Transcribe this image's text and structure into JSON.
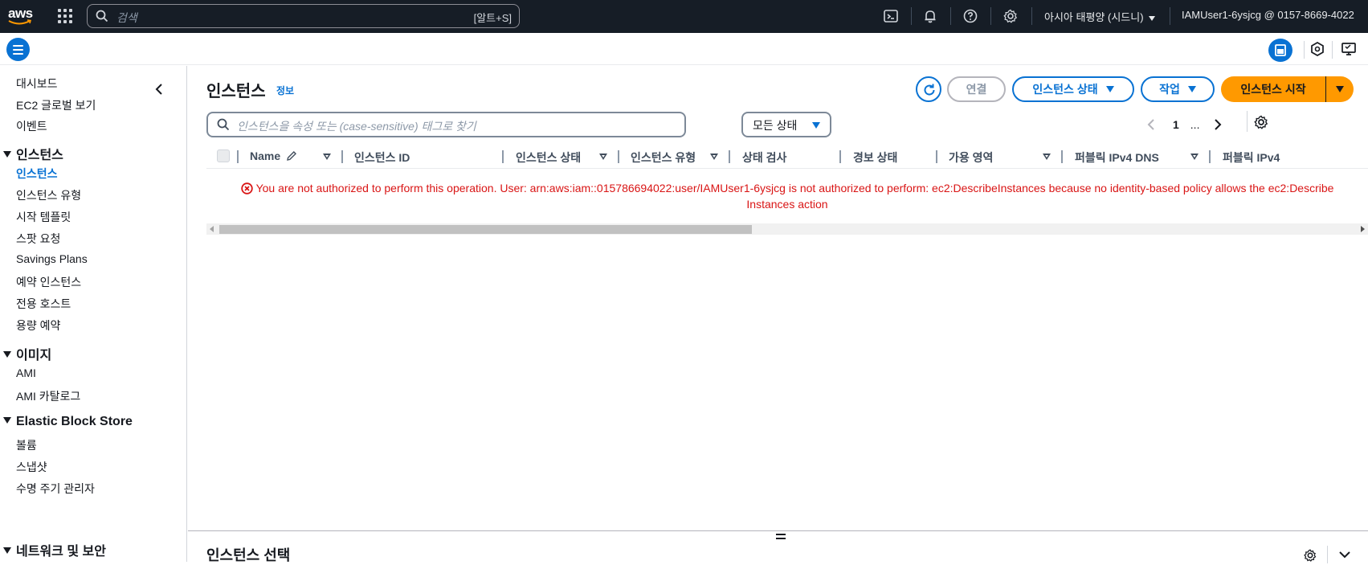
{
  "topnav": {
    "logo_text": "aws",
    "search": {
      "placeholder": "검색",
      "shortcut": "[알트+S]"
    },
    "icons": [
      "cloudshell-icon",
      "bell-icon",
      "help-icon",
      "gear-icon"
    ],
    "region_label": "아시아 태평양 (시드니)",
    "account_label": "IAMUser1-6ysjcg @ 0157-8669-4022"
  },
  "sidebar": {
    "items_top": [
      "대시보드",
      "EC2 글로벌 보기",
      "이벤트"
    ],
    "sections": [
      {
        "title": "인스턴스",
        "items": [
          "인스턴스",
          "인스턴스 유형",
          "시작 템플릿",
          "스팟 요청",
          "Savings Plans",
          "예약 인스턴스",
          "전용 호스트",
          "용량 예약"
        ]
      },
      {
        "title": "이미지",
        "items": [
          "AMI",
          "AMI 카탈로그"
        ]
      },
      {
        "title": "Elastic Block Store",
        "items": [
          "볼륨",
          "스냅샷",
          "수명 주기 관리자"
        ]
      },
      {
        "title": "네트워크 및 보안",
        "items": []
      }
    ],
    "active_item": "인스턴스"
  },
  "main": {
    "title": "인스턴스",
    "info_link": "정보",
    "buttons": {
      "connect": "연결",
      "instance_state": "인스턴스 상태",
      "actions": "작업",
      "launch": "인스턴스 시작"
    },
    "filter": {
      "placeholder": "인스턴스을 속성 또는 (case-sensitive) 태그로 찾기",
      "state_select": "모든 상태"
    },
    "pagination": {
      "current_page": "1",
      "ellipsis": "..."
    },
    "table": {
      "columns": [
        "Name",
        "인스턴스 ID",
        "인스턴스 상태",
        "인스턴스 유형",
        "상태 검사",
        "경보 상태",
        "가용 영역",
        "퍼블릭 IPv4 DNS",
        "퍼블릭 IPv4"
      ]
    },
    "error": {
      "line1": "You are not authorized to perform this operation. User: arn:aws:iam::015786694022:user/IAMUser1-6ysjcg is not authorized to perform: ec2:DescribeInstances because no identity-based policy allows the ec2:Describe",
      "line2": "Instances action"
    },
    "split_panel_title": "인스턴스 선택"
  },
  "colors": {
    "nav_bg": "#161d26",
    "accent": "#0972d3",
    "primary_button": "#ff9900",
    "error": "#d91515"
  }
}
